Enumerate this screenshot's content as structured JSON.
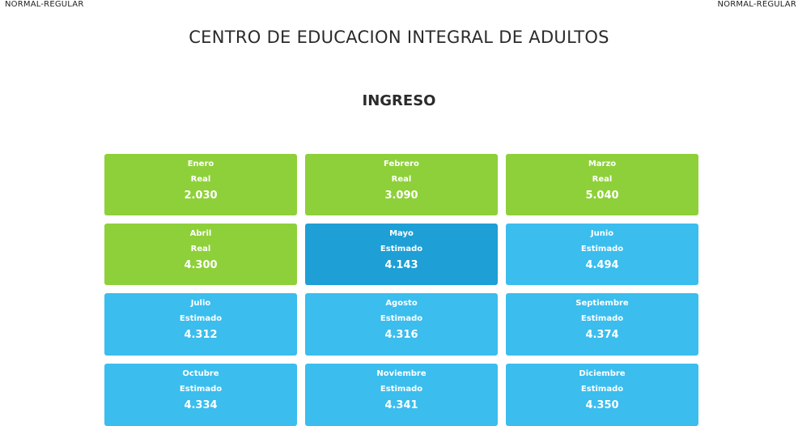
{
  "corner_left": "NORMAL-REGULAR",
  "corner_right": "NORMAL-REGULAR",
  "title": "CENTRO DE EDUCACION INTEGRAL DE ADULTOS",
  "section": "INGRESO",
  "colors": {
    "real": "#8ed03a",
    "estimated": "#3bbdee",
    "selected": "#1e9fd6"
  },
  "cards": [
    {
      "month": "Enero",
      "kind": "Real",
      "value": "2.030"
    },
    {
      "month": "Febrero",
      "kind": "Real",
      "value": "3.090"
    },
    {
      "month": "Marzo",
      "kind": "Real",
      "value": "5.040"
    },
    {
      "month": "Abril",
      "kind": "Real",
      "value": "4.300"
    },
    {
      "month": "Mayo",
      "kind": "Estimado",
      "value": "4.143"
    },
    {
      "month": "Junio",
      "kind": "Estimado",
      "value": "4.494"
    },
    {
      "month": "Julio",
      "kind": "Estimado",
      "value": "4.312"
    },
    {
      "month": "Agosto",
      "kind": "Estimado",
      "value": "4.316"
    },
    {
      "month": "Septiembre",
      "kind": "Estimado",
      "value": "4.374"
    },
    {
      "month": "Octubre",
      "kind": "Estimado",
      "value": "4.334"
    },
    {
      "month": "Noviembre",
      "kind": "Estimado",
      "value": "4.341"
    },
    {
      "month": "Diciembre",
      "kind": "Estimado",
      "value": "4.350"
    }
  ]
}
